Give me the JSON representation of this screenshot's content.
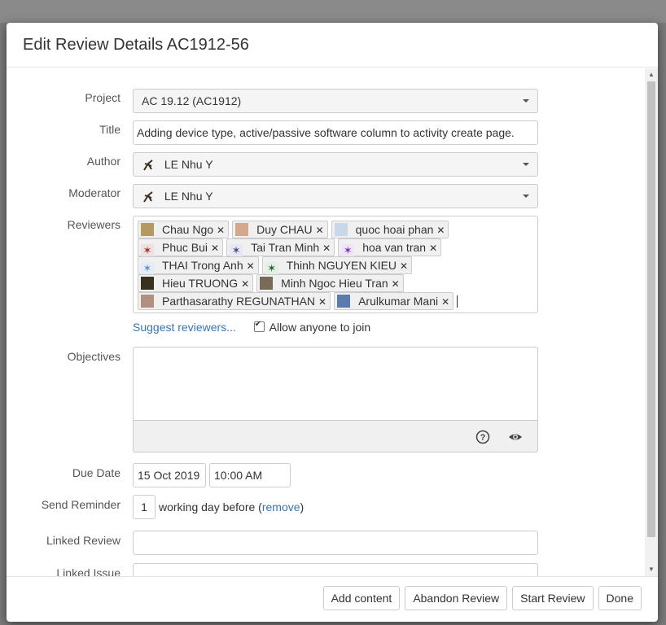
{
  "dialog": {
    "title": "Edit Review Details AC1912-56"
  },
  "form": {
    "project": {
      "label": "Project",
      "value": "AC 19.12 (AC1912)"
    },
    "title": {
      "label": "Title",
      "value": "Adding device type, active/passive software column to activity create page."
    },
    "author": {
      "label": "Author",
      "value": "LE Nhu Y"
    },
    "moderator": {
      "label": "Moderator",
      "value": "LE Nhu Y"
    },
    "reviewers": {
      "label": "Reviewers",
      "items": [
        "Chau Ngo",
        "Duy CHAU",
        "quoc hoai phan",
        "Phuc Bui",
        "Tai Tran Minh",
        "hoa van tran",
        "THAI Trong Anh",
        "Thinh NGUYEN KIEU",
        "Hieu TRUONG",
        "Minh Ngoc Hieu Tran",
        "Parthasarathy REGUNATHAN",
        "Arulkumar Mani"
      ]
    },
    "suggest_reviewers": "Suggest reviewers...",
    "allow_anyone": "Allow anyone to join",
    "objectives": {
      "label": "Objectives",
      "value": ""
    },
    "due_date": {
      "label": "Due Date",
      "date": "15 Oct 2019",
      "time": "10:00 AM"
    },
    "send_reminder": {
      "label": "Send Reminder",
      "days": "1",
      "text": "working day before (",
      "remove": "remove",
      "close": ")"
    },
    "linked_review": {
      "label": "Linked Review",
      "value": ""
    },
    "linked_issue": {
      "label": "Linked Issue",
      "value": ""
    }
  },
  "footer": {
    "add_content": "Add content",
    "abandon": "Abandon Review",
    "start": "Start Review",
    "done": "Done"
  },
  "colors": {
    "link": "#3b73af",
    "border": "#cccccc"
  }
}
